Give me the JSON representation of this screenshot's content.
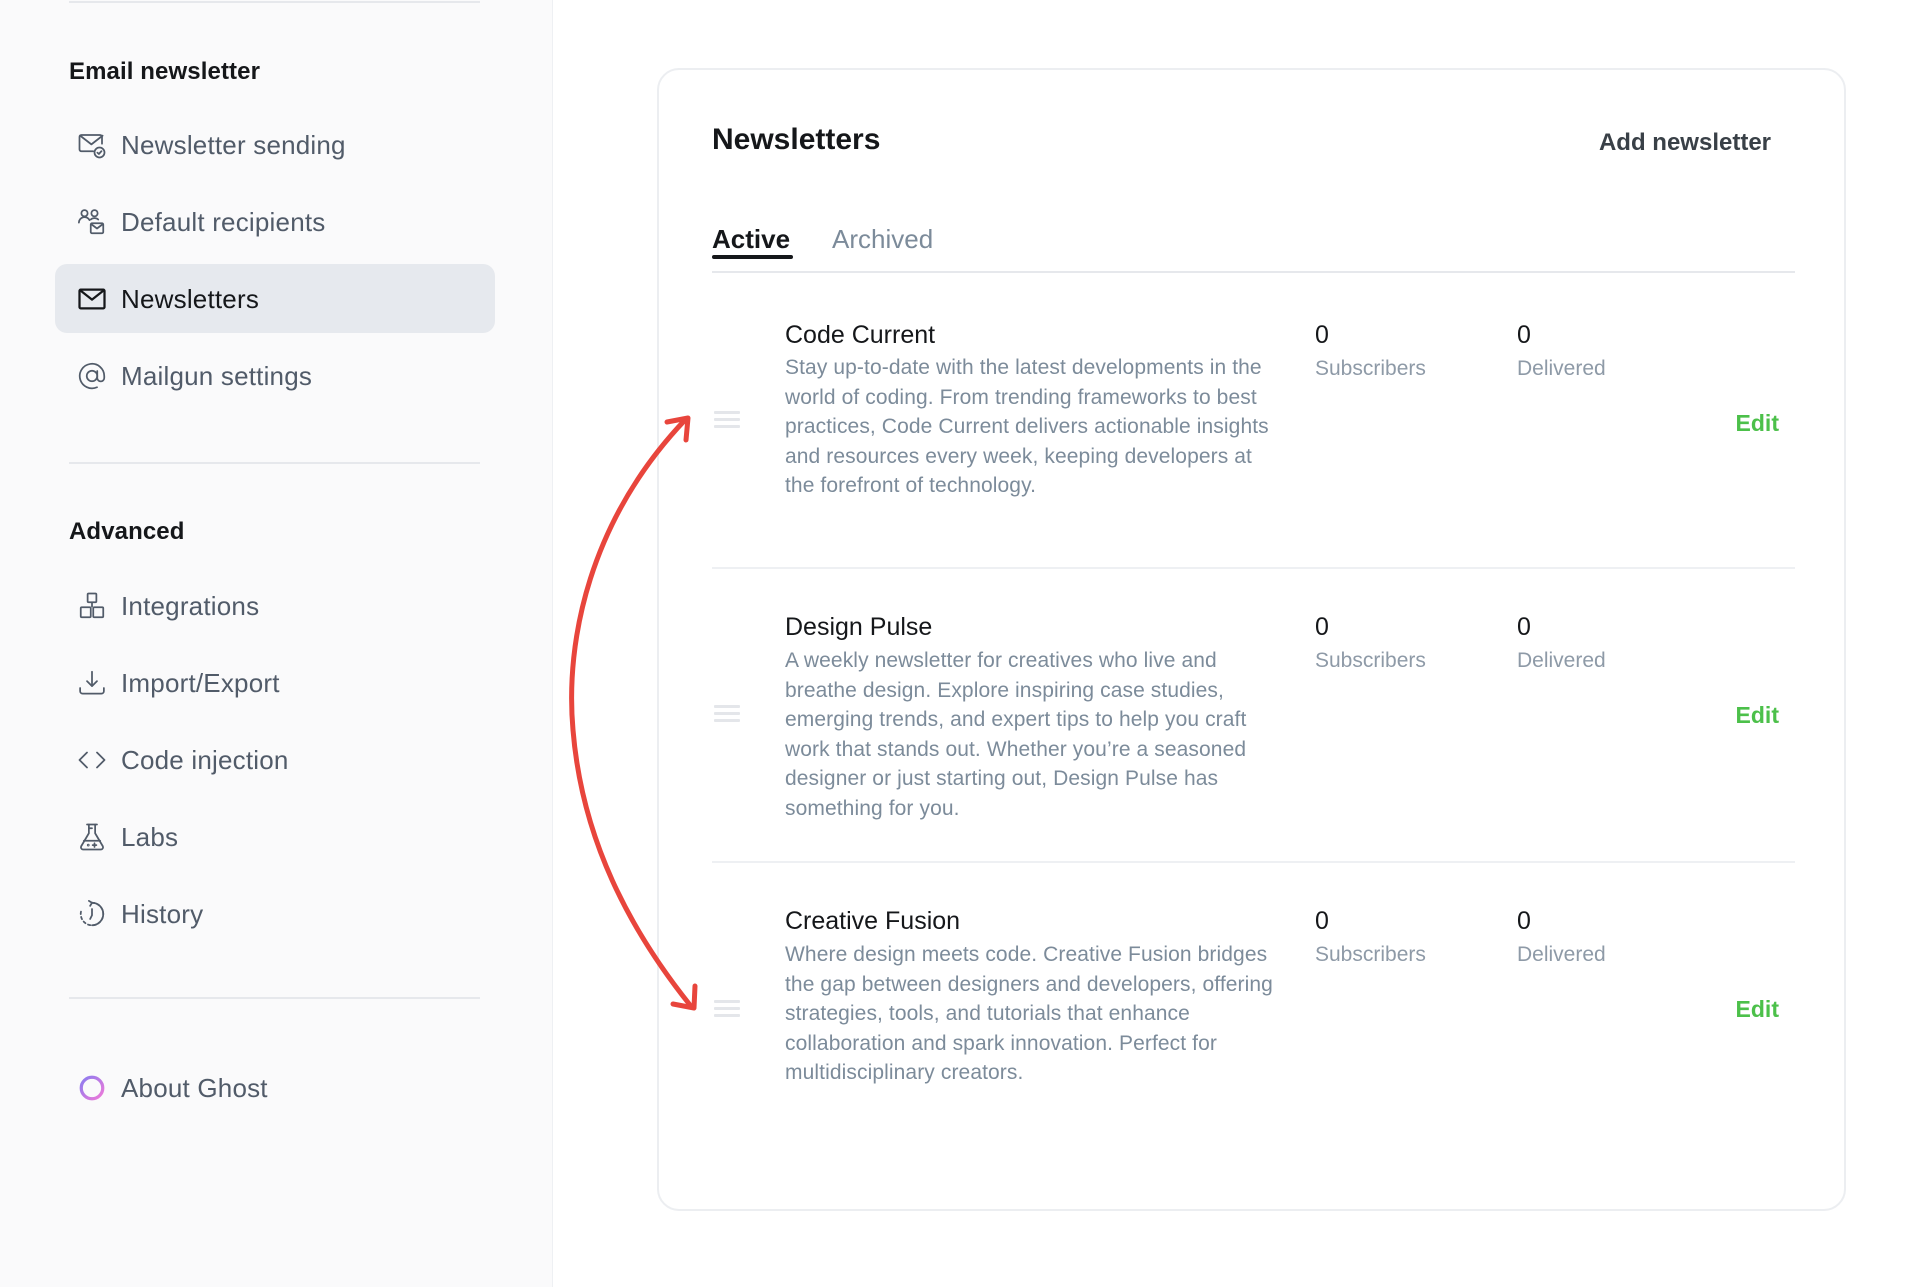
{
  "sidebar": {
    "sections": [
      {
        "heading": "Email newsletter",
        "items": [
          {
            "label": "Newsletter sending",
            "icon": "email-check-icon",
            "active": false
          },
          {
            "label": "Default recipients",
            "icon": "recipients-icon",
            "active": false
          },
          {
            "label": "Newsletters",
            "icon": "envelope-icon",
            "active": true
          },
          {
            "label": "Mailgun settings",
            "icon": "at-sign-icon",
            "active": false
          }
        ]
      },
      {
        "heading": "Advanced",
        "items": [
          {
            "label": "Integrations",
            "icon": "integrations-icon",
            "active": false
          },
          {
            "label": "Import/Export",
            "icon": "download-icon",
            "active": false
          },
          {
            "label": "Code injection",
            "icon": "code-icon",
            "active": false
          },
          {
            "label": "Labs",
            "icon": "flask-icon",
            "active": false
          },
          {
            "label": "History",
            "icon": "history-icon",
            "active": false
          }
        ]
      }
    ],
    "about": {
      "label": "About Ghost",
      "icon": "ghost-ring-icon"
    }
  },
  "main": {
    "title": "Newsletters",
    "add_button": "Add newsletter",
    "tabs": [
      {
        "label": "Active",
        "active": true
      },
      {
        "label": "Archived",
        "active": false
      }
    ],
    "newsletters": [
      {
        "name": "Code Current",
        "description": "Stay up-to-date with the latest developments in the world of coding. From trending frameworks to best practices, Code Current delivers actionable insights and resources every week, keeping developers at the forefront of technology.",
        "subscribers": "0",
        "subscribers_label": "Subscribers",
        "delivered": "0",
        "delivered_label": "Delivered",
        "edit_label": "Edit"
      },
      {
        "name": "Design Pulse",
        "description": "A weekly newsletter for creatives who live and breathe design. Explore inspiring case studies, emerging trends, and expert tips to help you craft work that stands out. Whether you’re a seasoned designer or just starting out, Design Pulse has something for you.",
        "subscribers": "0",
        "subscribers_label": "Subscribers",
        "delivered": "0",
        "delivered_label": "Delivered",
        "edit_label": "Edit"
      },
      {
        "name": "Creative Fusion",
        "description": "Where design meets code. Creative Fusion bridges the gap between designers and developers, offering strategies, tools, and tutorials that enhance collaboration and spark innovation. Perfect for multidisciplinary creators.",
        "subscribers": "0",
        "subscribers_label": "Subscribers",
        "delivered": "0",
        "delivered_label": "Delivered",
        "edit_label": "Edit"
      }
    ]
  },
  "colors": {
    "accent_green": "#4cc04a",
    "annotation_red": "#e8453c",
    "active_nav_bg": "#e6e9ee"
  },
  "annotation": {
    "type": "curved-double-arrow",
    "from": "Code Current drag handle",
    "to": "Creative Fusion drag handle"
  }
}
